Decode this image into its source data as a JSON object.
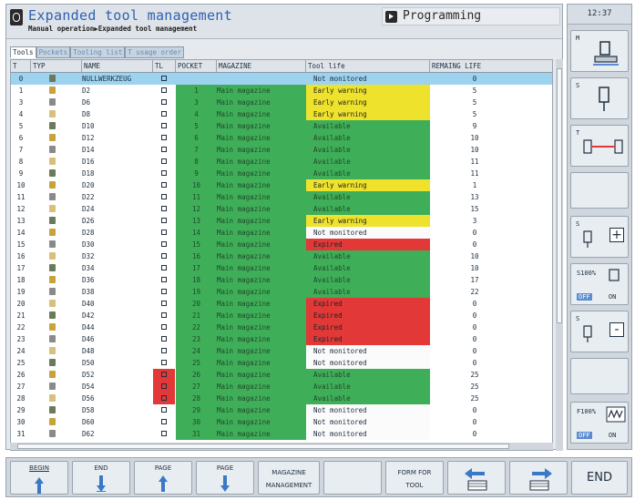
{
  "window": {
    "title": "Expanded tool management",
    "breadcrumb": "Manual operation▶Expanded tool management",
    "mode": "Programming",
    "clock": "12:37"
  },
  "tabs": [
    "Tools",
    "Pockets",
    "Tooling list",
    "T usage order"
  ],
  "columns": [
    "T",
    "TYP",
    "NAME",
    "TL",
    "POCKET",
    "MAGAZINE",
    "Tool life",
    "REMAING LIFE"
  ],
  "rows": [
    {
      "t": "0",
      "name": "NULLWERKZEUG",
      "pocket": "",
      "mag": "",
      "life": "Not monitored",
      "rem": "0",
      "status": "none"
    },
    {
      "t": "1",
      "name": "D2",
      "pocket": "1",
      "mag": "Main magazine",
      "life": "Early warning",
      "rem": "5",
      "status": "warn"
    },
    {
      "t": "3",
      "name": "D6",
      "pocket": "3",
      "mag": "Main magazine",
      "life": "Early warning",
      "rem": "5",
      "status": "warn"
    },
    {
      "t": "4",
      "name": "D8",
      "pocket": "4",
      "mag": "Main magazine",
      "life": "Early warning",
      "rem": "5",
      "status": "warn"
    },
    {
      "t": "5",
      "name": "D10",
      "pocket": "5",
      "mag": "Main magazine",
      "life": "Available",
      "rem": "9",
      "status": "ok"
    },
    {
      "t": "6",
      "name": "D12",
      "pocket": "6",
      "mag": "Main magazine",
      "life": "Available",
      "rem": "10",
      "status": "ok"
    },
    {
      "t": "7",
      "name": "D14",
      "pocket": "7",
      "mag": "Main magazine",
      "life": "Available",
      "rem": "10",
      "status": "ok"
    },
    {
      "t": "8",
      "name": "D16",
      "pocket": "8",
      "mag": "Main magazine",
      "life": "Available",
      "rem": "11",
      "status": "ok"
    },
    {
      "t": "9",
      "name": "D18",
      "pocket": "9",
      "mag": "Main magazine",
      "life": "Available",
      "rem": "11",
      "status": "ok"
    },
    {
      "t": "10",
      "name": "D20",
      "pocket": "10",
      "mag": "Main magazine",
      "life": "Early warning",
      "rem": "1",
      "status": "warn"
    },
    {
      "t": "11",
      "name": "D22",
      "pocket": "11",
      "mag": "Main magazine",
      "life": "Available",
      "rem": "13",
      "status": "ok"
    },
    {
      "t": "12",
      "name": "D24",
      "pocket": "12",
      "mag": "Main magazine",
      "life": "Available",
      "rem": "15",
      "status": "ok"
    },
    {
      "t": "13",
      "name": "D26",
      "pocket": "13",
      "mag": "Main magazine",
      "life": "Early warning",
      "rem": "3",
      "status": "warn"
    },
    {
      "t": "14",
      "name": "D28",
      "pocket": "14",
      "mag": "Main magazine",
      "life": "Not monitored",
      "rem": "0",
      "status": "none"
    },
    {
      "t": "15",
      "name": "D30",
      "pocket": "15",
      "mag": "Main magazine",
      "life": "Expired",
      "rem": "0",
      "status": "exp"
    },
    {
      "t": "16",
      "name": "D32",
      "pocket": "16",
      "mag": "Main magazine",
      "life": "Available",
      "rem": "10",
      "status": "ok"
    },
    {
      "t": "17",
      "name": "D34",
      "pocket": "17",
      "mag": "Main magazine",
      "life": "Available",
      "rem": "10",
      "status": "ok"
    },
    {
      "t": "18",
      "name": "D36",
      "pocket": "18",
      "mag": "Main magazine",
      "life": "Available",
      "rem": "17",
      "status": "ok"
    },
    {
      "t": "19",
      "name": "D38",
      "pocket": "19",
      "mag": "Main magazine",
      "life": "Available",
      "rem": "22",
      "status": "ok"
    },
    {
      "t": "20",
      "name": "D40",
      "pocket": "20",
      "mag": "Main magazine",
      "life": "Expired",
      "rem": "0",
      "status": "exp"
    },
    {
      "t": "21",
      "name": "D42",
      "pocket": "21",
      "mag": "Main magazine",
      "life": "Expired",
      "rem": "0",
      "status": "exp"
    },
    {
      "t": "22",
      "name": "D44",
      "pocket": "22",
      "mag": "Main magazine",
      "life": "Expired",
      "rem": "0",
      "status": "exp"
    },
    {
      "t": "23",
      "name": "D46",
      "pocket": "23",
      "mag": "Main magazine",
      "life": "Expired",
      "rem": "0",
      "status": "exp"
    },
    {
      "t": "24",
      "name": "D48",
      "pocket": "24",
      "mag": "Main magazine",
      "life": "Not monitored",
      "rem": "0",
      "status": "none"
    },
    {
      "t": "25",
      "name": "D50",
      "pocket": "25",
      "mag": "Main magazine",
      "life": "Not monitored",
      "rem": "0",
      "status": "none"
    },
    {
      "t": "26",
      "name": "D52",
      "pocket": "26",
      "mag": "Main magazine",
      "life": "Available",
      "rem": "25",
      "status": "ok",
      "tl_locked": true
    },
    {
      "t": "27",
      "name": "D54",
      "pocket": "27",
      "mag": "Main magazine",
      "life": "Available",
      "rem": "25",
      "status": "ok",
      "tl_locked": true
    },
    {
      "t": "28",
      "name": "D56",
      "pocket": "28",
      "mag": "Main magazine",
      "life": "Available",
      "rem": "25",
      "status": "ok",
      "tl_locked": true
    },
    {
      "t": "29",
      "name": "D58",
      "pocket": "29",
      "mag": "Main magazine",
      "life": "Not monitored",
      "rem": "0",
      "status": "none"
    },
    {
      "t": "30",
      "name": "D60",
      "pocket": "30",
      "mag": "Main magazine",
      "life": "Not monitored",
      "rem": "0",
      "status": "none"
    },
    {
      "t": "31",
      "name": "D62",
      "pocket": "31",
      "mag": "Main magazine",
      "life": "Not monitored",
      "rem": "0",
      "status": "none"
    }
  ],
  "colors": {
    "available": "#3fae58",
    "early_warning": "#eee22c",
    "expired": "#e23838",
    "selected_row": "#9dd3ef"
  },
  "right_panel": {
    "labels": [
      "M",
      "S",
      "T",
      "S",
      "S100%",
      "S",
      "F100%"
    ],
    "off_label": "OFF",
    "on_label": "ON",
    "plus": "+",
    "minus": "-"
  },
  "softkeys": [
    {
      "line1": "BEGIN",
      "line2": "",
      "icon": "arrow-up-icon"
    },
    {
      "line1": "END",
      "line2": "",
      "icon": "arrow-down-icon"
    },
    {
      "line1": "PAGE",
      "line2": "",
      "icon": "arrow-up-icon"
    },
    {
      "line1": "PAGE",
      "line2": "",
      "icon": "arrow-down-icon"
    },
    {
      "line1": "MAGAZINE",
      "line2": "MANAGEMENT",
      "icon": ""
    },
    {
      "line1": "",
      "line2": "",
      "icon": ""
    },
    {
      "line1": "FORM FOR",
      "line2": "TOOL",
      "icon": ""
    },
    {
      "line1": "",
      "line2": "",
      "icon": "table-left-icon"
    },
    {
      "line1": "",
      "line2": "",
      "icon": "table-right-icon"
    },
    {
      "line1": "END",
      "line2": "",
      "icon": ""
    }
  ]
}
